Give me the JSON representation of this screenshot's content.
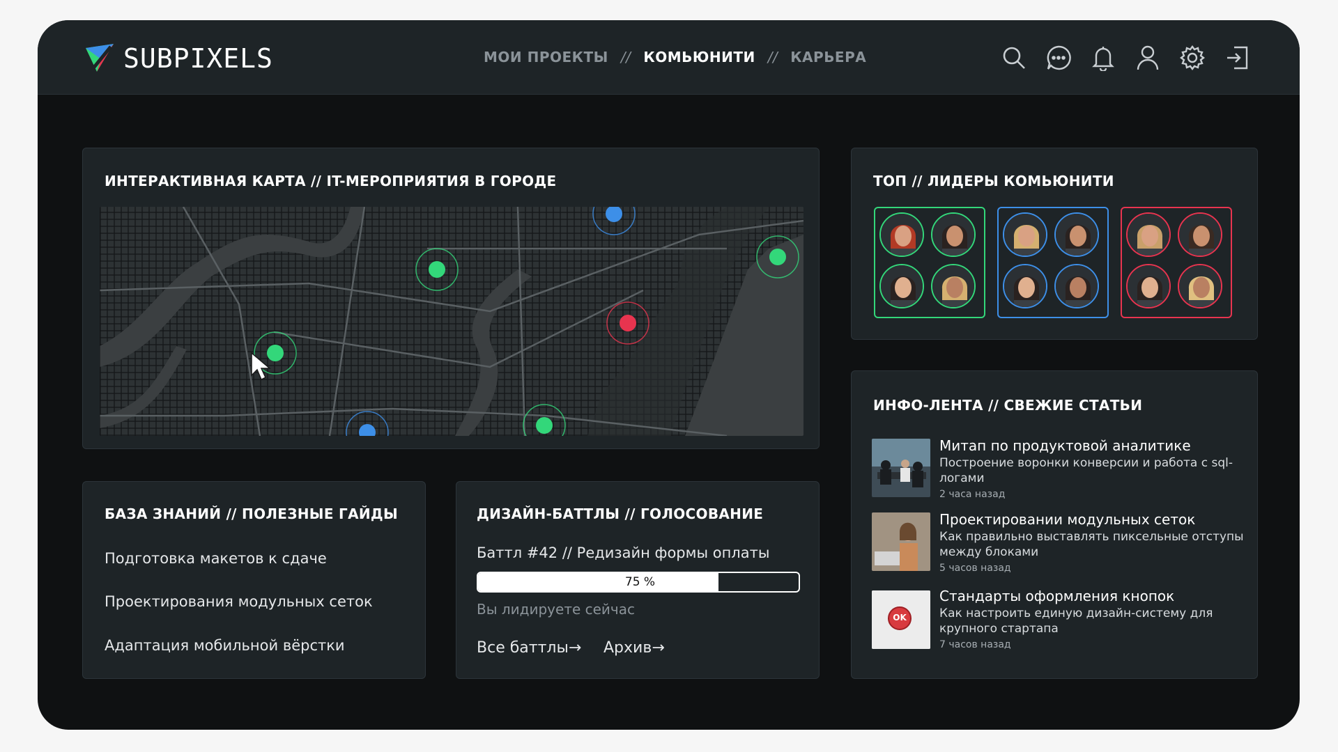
{
  "brand": {
    "name": "SUBPIXELS"
  },
  "nav": {
    "items": [
      "МОИ ПРОЕКТЫ",
      "КОМЬЮНИТИ",
      "КАРЬЕРА"
    ],
    "active": "КОМЬЮНИТИ",
    "separator": "//"
  },
  "header_icons": [
    "search-icon",
    "chat-icon",
    "bell-icon",
    "user-icon",
    "gear-icon",
    "logout-icon"
  ],
  "map_card": {
    "title": "ИНТЕРАКТИВНАЯ КАРТА // IT-МЕРОПРИЯТИЯ В ГОРОДЕ",
    "marker_colors": {
      "green": "#33d77a",
      "blue": "#3d8fe8",
      "red": "#e8344f"
    }
  },
  "leaders_card": {
    "title": "ТОП // ЛИДЕРЫ КОМЬЮНИТИ",
    "group_colors": [
      "#33d77a",
      "#3d8fe8",
      "#e8344f"
    ]
  },
  "knowledge_card": {
    "title": "БАЗА ЗНАНИЙ // ПОЛЕЗНЫЕ ГАЙДЫ",
    "items": [
      "Подготовка макетов к сдаче",
      "Проектирования модульных сеток",
      "Адаптация мобильной вёрстки"
    ]
  },
  "battle_card": {
    "title": "ДИЗАЙН-БАТТЛЫ // ГОЛОСОВАНИЕ",
    "battle_name": "Баттл #42  //  Редизайн формы оплаты",
    "progress": 0.75,
    "progress_label": "75 %",
    "status": "Вы лидируете сейчас",
    "link_all": "Все баттлы",
    "link_archive": "Архив"
  },
  "feed_card": {
    "title": "ИНФО-ЛЕНТА // СВЕЖИЕ СТАТЬИ",
    "items": [
      {
        "title": "Митап по продуктовой аналитике",
        "desc": "Построение воронки конверсии и работа с sql-логами",
        "time": "2 часа назад"
      },
      {
        "title": "Проектировании модульных сеток",
        "desc": "Как правильно выставлять пиксельные отступы между блоками",
        "time": "5 часов назад"
      },
      {
        "title": "Стандарты оформления кнопок",
        "desc": "Как настроить единую дизайн-систему для крупного стартапа",
        "time": "7 часов назад",
        "badge": "OK"
      }
    ]
  }
}
